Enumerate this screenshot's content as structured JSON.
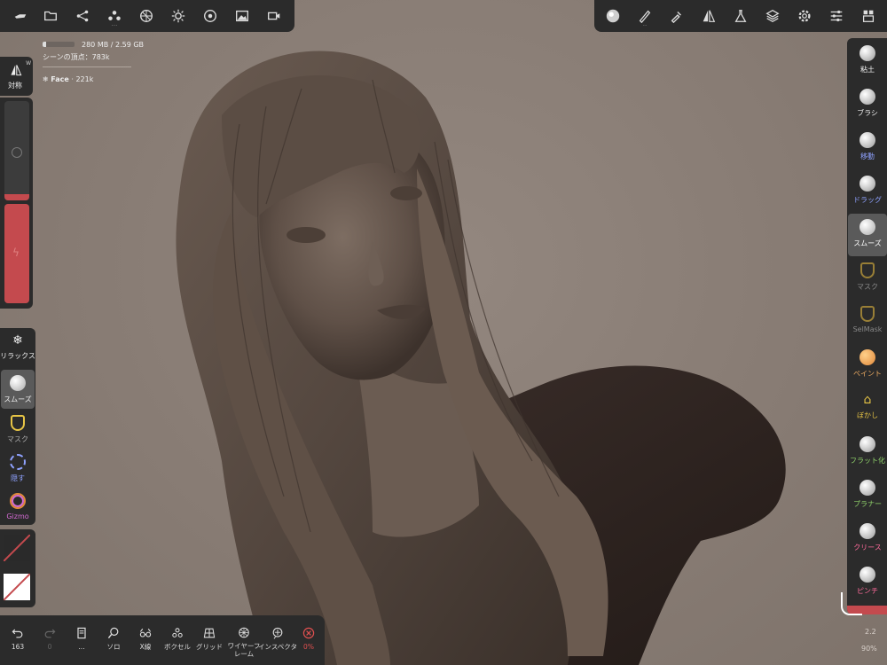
{
  "colors": {
    "panel": "#2b2b2b",
    "active": "#5a5a5a",
    "accent_red": "#c44a4e",
    "paint_orange": "#e0883a",
    "green_label": "#8fd16a",
    "blue_label": "#8fa2ff",
    "pink_label": "#ff6b9b",
    "magenta_label": "#d46bd4",
    "yellow_icon": "#e6c445"
  },
  "top_left_toolbar": {
    "icons": [
      "menu-icon",
      "folder-icon",
      "scene-graph-icon",
      "primitive-icon",
      "topology-icon",
      "light-icon",
      "material-icon",
      "image-icon",
      "video-icon"
    ]
  },
  "top_right_toolbar": {
    "icons": [
      "brush-sphere-icon",
      "stroke-icon",
      "picker-icon",
      "symmetry-icon",
      "flask-icon",
      "layers-icon",
      "settings-icon",
      "sliders-icon",
      "tools-grid-icon"
    ]
  },
  "stats": {
    "memory": "280 MB / 2.59 GB",
    "memory_fraction": 0.11,
    "vertices": "シーンの頂点：783k",
    "object_name": "Face",
    "object_count": "· 221k"
  },
  "left_panel": {
    "symmetry": {
      "label": "対称",
      "badge": "W"
    },
    "radius_percent": 0.06,
    "intensity_percent": 1.0
  },
  "left_tools": [
    {
      "icon": "relax-icon",
      "label": "リラックス"
    },
    {
      "icon": "smooth-icon",
      "label": "スムーズ"
    },
    {
      "icon": "mask-icon",
      "label": "マスク"
    },
    {
      "icon": "hide-icon",
      "label": "隠す"
    },
    {
      "icon": "gizmo-icon",
      "label": "Gizmo"
    }
  ],
  "right_tools": [
    {
      "icon": "clay-icon",
      "label": "粘土"
    },
    {
      "icon": "brush-icon",
      "label": "ブラシ"
    },
    {
      "icon": "move-icon",
      "label": "移動"
    },
    {
      "icon": "drag-icon",
      "label": "ドラッグ"
    },
    {
      "icon": "smooth-icon",
      "label": "スムーズ"
    },
    {
      "icon": "mask-icon",
      "label": "マスク"
    },
    {
      "icon": "selmask-icon",
      "label": "SelMask"
    },
    {
      "icon": "paint-icon",
      "label": "ペイント"
    },
    {
      "icon": "blur-icon",
      "label": "ぼかし"
    },
    {
      "icon": "flatten-icon",
      "label": "フラット化"
    },
    {
      "icon": "planar-icon",
      "label": "プラナー"
    },
    {
      "icon": "crease-icon",
      "label": "クリース"
    },
    {
      "icon": "pinch-icon",
      "label": "ピンチ"
    }
  ],
  "bottom_toolbar": [
    {
      "icon": "undo-icon",
      "label": "163"
    },
    {
      "icon": "redo-icon",
      "label": "0"
    },
    {
      "icon": "sculpt-layer-icon",
      "label": "..."
    },
    {
      "icon": "solo-icon",
      "label": "ソロ"
    },
    {
      "icon": "xray-icon",
      "label": "X線"
    },
    {
      "icon": "voxel-icon",
      "label": "ボクセル"
    },
    {
      "icon": "grid-icon",
      "label": "グリッド"
    },
    {
      "icon": "wireframe-icon",
      "label": "ワイヤーフ\nレーム"
    },
    {
      "icon": "inspector-icon",
      "label": "インスペクタ"
    },
    {
      "icon": "close-circle-icon",
      "label": "0%"
    }
  ],
  "viewport_info": {
    "version": "2.2",
    "zoom": "90%"
  }
}
